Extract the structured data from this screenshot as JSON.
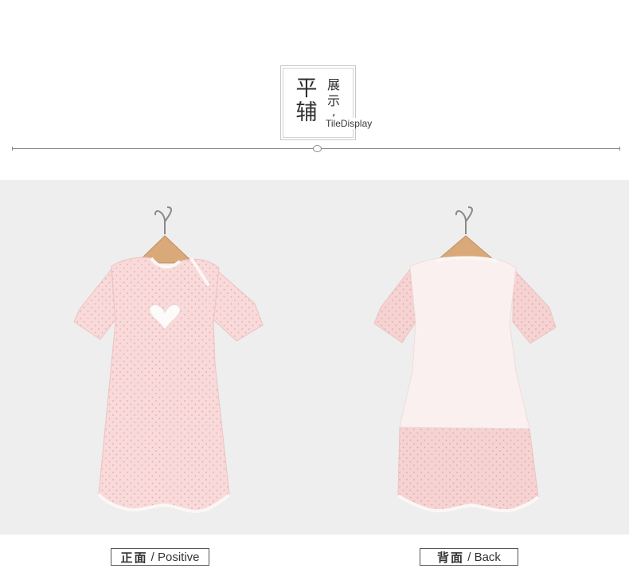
{
  "header": {
    "title_char_1": "平",
    "title_char_2": "辅",
    "small_char_1": "展",
    "small_char_2": "示",
    "comma": ",",
    "english": "TileDisplay"
  },
  "images": {
    "front_alt": "front",
    "back_alt": "back"
  },
  "captions": {
    "front": {
      "zh": "正面",
      "sep": " / ",
      "en": "Positive"
    },
    "back": {
      "zh": "背面",
      "sep": " / ",
      "en": "Back"
    }
  },
  "colors": {
    "photo_bg": "#eeeeee",
    "garment_pink": "#f8dada",
    "dot_pink": "#eca6a8",
    "trim_white": "#fbf7f5",
    "hanger_wood": "#d9a97a",
    "hook_metal": "#8a8a8a",
    "divider": "#8a8a8a"
  }
}
